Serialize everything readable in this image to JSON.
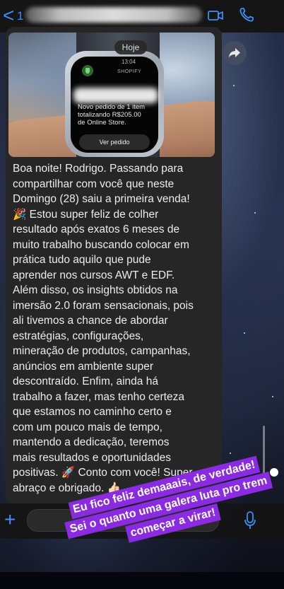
{
  "header": {
    "back_label": "<",
    "unread_count": "1",
    "icons": [
      "video-call-icon",
      "phone-call-icon"
    ],
    "accent_color": "#3e8ef7"
  },
  "date_separator": "Hoje",
  "forward_icon": "forward-arrow-icon",
  "message": {
    "image": {
      "watch_time": "13:04",
      "watch_app": "SHOPIFY",
      "notification_text": "Novo pedido de 1 item\ntotalizando R$205.00\nde Online Store.",
      "button_label": "Ver pedido"
    },
    "text": "Boa noite! Rodrigo. Passando para\ncompartilhar com você que neste\nDomingo (28) saiu a primeira venda!\n🎉 Estou super feliz de colher\nresultado após exatos 6 meses de\nmuito trabalho buscando colocar em\nprática tudo aquilo que pude\naprender nos cursos AWT e EDF.\nAlém disso, os insights obtidos na\nimersão 2.0 foram sensacionais, pois\nali tivemos a chance de abordar\nestratégias, configurações,\nmineração de produtos, campanhas,\nanúncios em ambiente super\ndescontraído. Enfim, ainda há\ntrabalho a fazer, mas tenho certeza\nque estamos no caminho certo e\ncom um pouco mais de tempo,\nmantendo a dedicação, teremos\nmais resultados e oportunidades\npositivas. 🚀 Conto com você! Super\nabraço e obrigado. 👍🏻"
  },
  "input": {
    "plus_label": "+",
    "placeholder": ""
  },
  "overlay": {
    "line1": "Eu fico feliz demaaais, de verdade!",
    "line2": "Sei o quanto uma galera luta pro trem",
    "line3": "começar a virar!",
    "color": "#8a2be2"
  }
}
